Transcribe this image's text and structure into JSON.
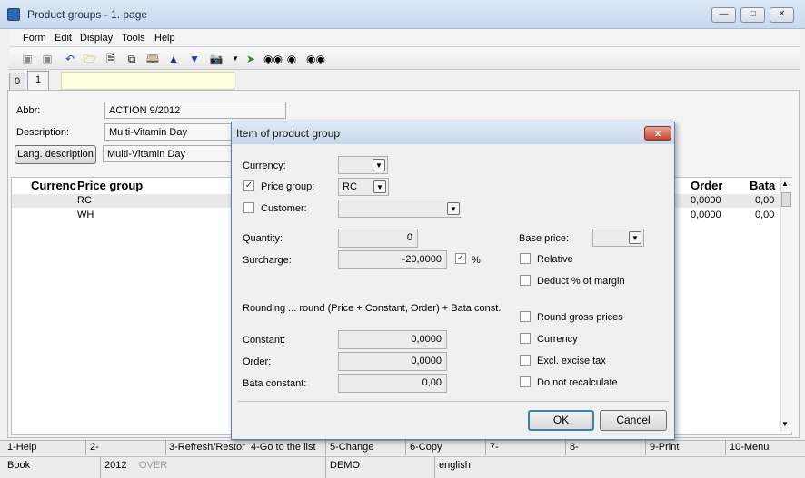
{
  "window": {
    "title": "Product groups - 1. page",
    "min_label": "—",
    "max_label": "□",
    "close_label": "✕"
  },
  "menu": [
    "Form",
    "Edit",
    "Display",
    "Tools",
    "Help"
  ],
  "toolbar": [
    "save-icon",
    "save-as-icon",
    "undo-icon",
    "open-folder-icon",
    "new-document-icon",
    "copy-icon",
    "book-icon",
    "arrow-up-icon",
    "arrow-down-icon",
    "camera-icon",
    "dropdown-arrow-icon",
    "green-arrow-icon",
    "binoculars-icon",
    "find-next-icon",
    "find-all-icon"
  ],
  "tabs": [
    "0",
    "1"
  ],
  "form": {
    "abbr_label": "Abbr:",
    "abbr_value": "ACTION 9/2012",
    "desc_label": "Description:",
    "desc_value": "Multi-Vitamin Day",
    "lang_button": "Lang. description",
    "lang_value": "Multi-Vitamin Day"
  },
  "grid": {
    "headers": [
      "Currenc",
      "Price group",
      "Order",
      "Bata"
    ],
    "rows": [
      {
        "group": "RC",
        "order": "0,0000",
        "bata": "0,00"
      },
      {
        "group": "WH",
        "order": "0,0000",
        "bata": "0,00"
      }
    ]
  },
  "dialog": {
    "title": "Item of product group",
    "close_label": "x",
    "currency_label": "Currency:",
    "currency_value": "",
    "price_group_label": "Price group:",
    "price_group_checked": true,
    "price_group_value": "RC",
    "customer_label": "Customer:",
    "customer_checked": false,
    "customer_value": "",
    "quantity_label": "Quantity:",
    "quantity_value": "0",
    "surcharge_label": "Surcharge:",
    "surcharge_value": "-20,0000",
    "percent_checked": true,
    "percent_label": "%",
    "base_price_label": "Base price:",
    "relative_label": "Relative",
    "deduct_label": "Deduct % of margin",
    "rounding_text": "Rounding ... round (Price + Constant, Order) + Bata const.",
    "round_gross_label": "Round gross prices",
    "currency_chk_label": "Currency",
    "excl_excise_label": "Excl. excise tax",
    "no_recalc_label": "Do not recalculate",
    "constant_label": "Constant:",
    "constant_value": "0,0000",
    "order_label": "Order:",
    "order_value": "0,0000",
    "bata_label": "Bata constant:",
    "bata_value": "0,00",
    "ok_label": "OK",
    "cancel_label": "Cancel"
  },
  "fkeys": [
    "1-Help",
    "2-",
    "3-Refresh/Restor",
    "4-Go to the list",
    "5-Change",
    "6-Copy",
    "7-",
    "8-",
    "9-Print",
    "10-Menu"
  ],
  "status": {
    "book": "Book",
    "year": "2012",
    "over": "OVER",
    "db": "DEMO",
    "lang": "english"
  }
}
